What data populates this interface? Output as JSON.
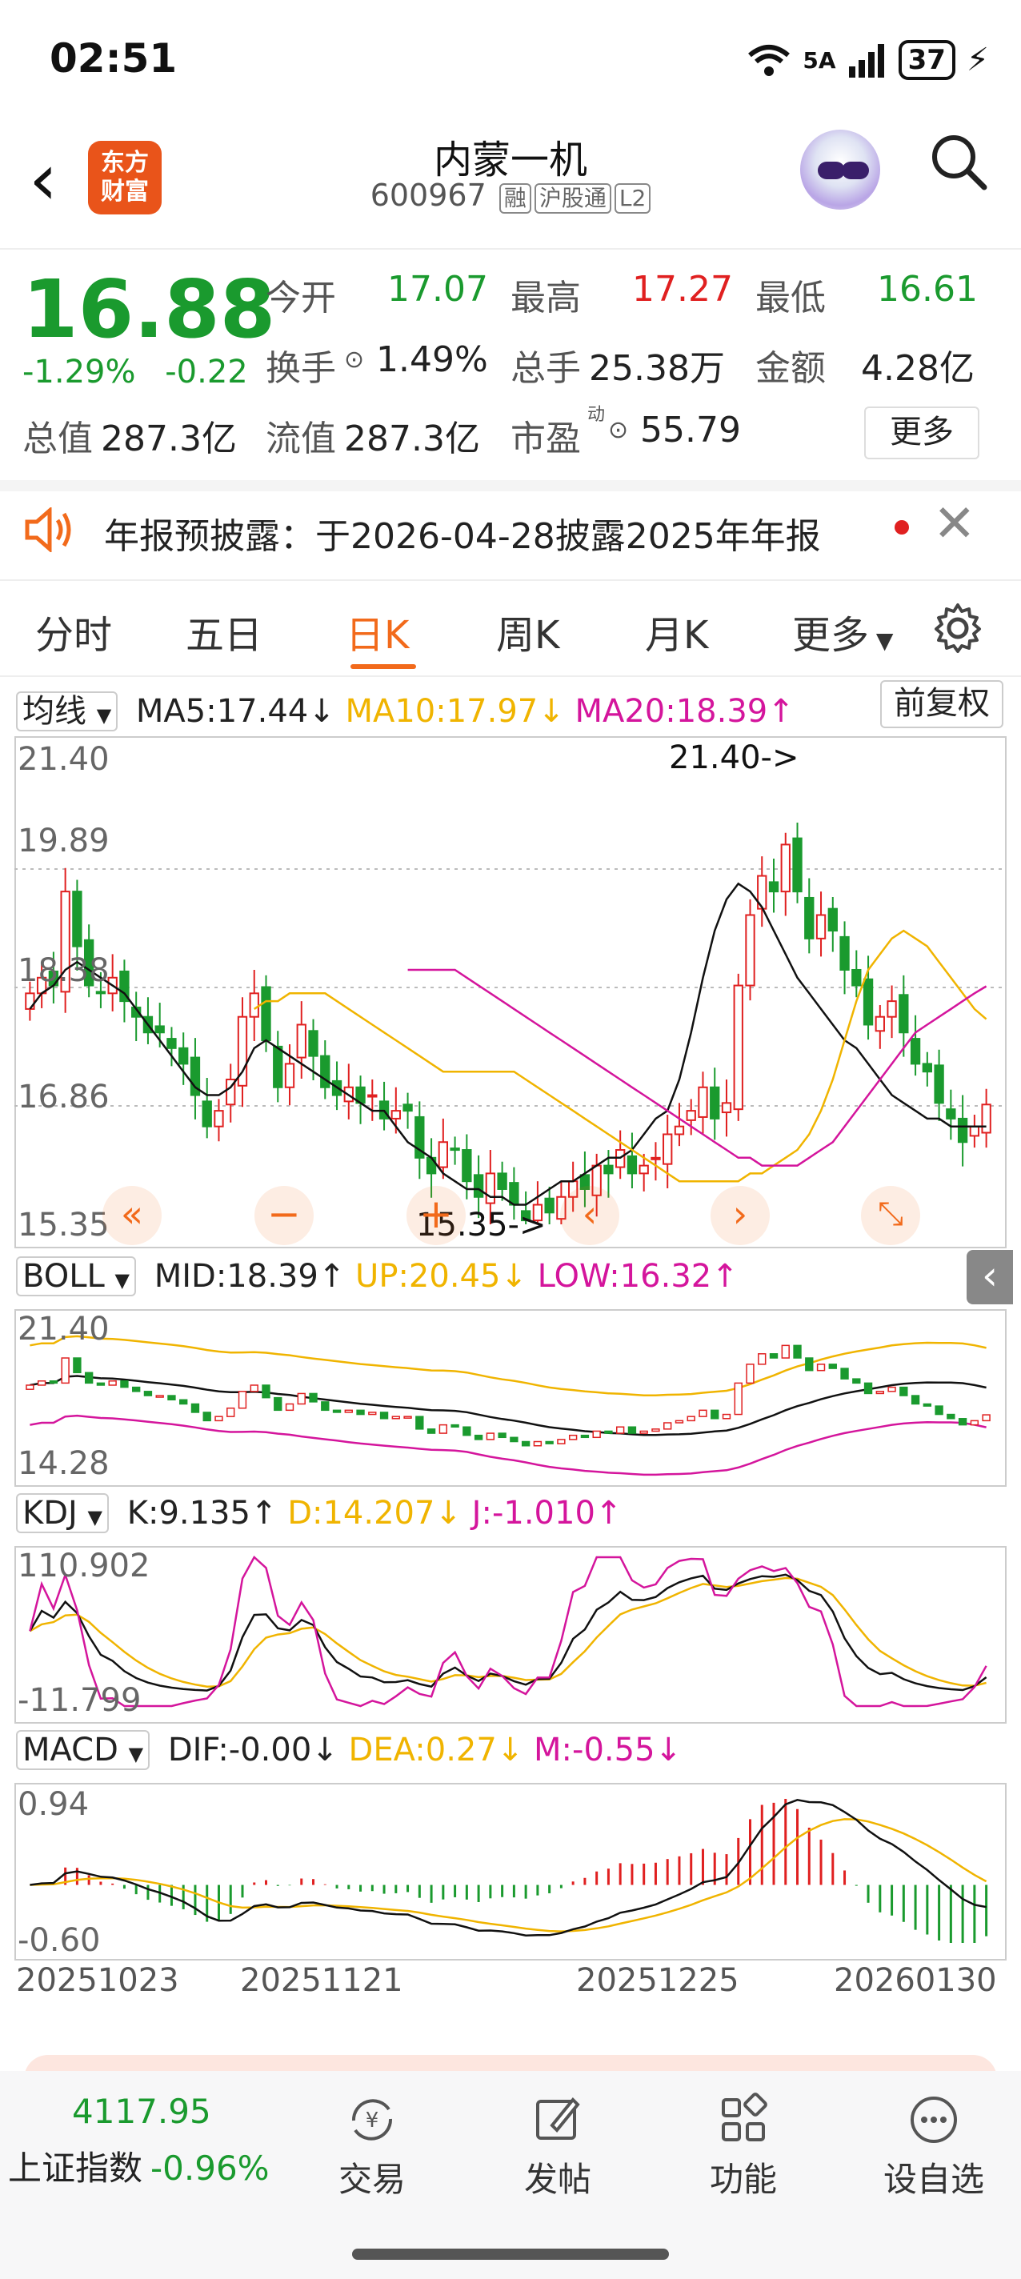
{
  "status": {
    "time": "02:51",
    "network": "5A",
    "battery": "37"
  },
  "header": {
    "title": "内蒙一机",
    "code": "600967",
    "tags": [
      "融",
      "沪股通",
      "L2"
    ],
    "logo_line1": "东方",
    "logo_line2": "财富"
  },
  "quote": {
    "price": "16.88",
    "change_pct": "-1.29%",
    "change_amt": "-0.22",
    "open_label": "今开",
    "open": "17.07",
    "high_label": "最高",
    "high": "17.27",
    "low_label": "最低",
    "low": "16.61",
    "turnover_label": "换手",
    "turnover": "1.49%",
    "volume_label": "总手",
    "volume": "25.38万",
    "amount_label": "金额",
    "amount": "4.28亿",
    "mcap_label": "总值",
    "mcap": "287.3亿",
    "float_label": "流值",
    "float_cap": "287.3亿",
    "pe_label": "市盈",
    "pe_sup": "动",
    "pe": "55.79",
    "more_button": "更多"
  },
  "notice": {
    "text": "年报预披露：于2026-04-28披露2025年年报"
  },
  "tabs": [
    "分时",
    "五日",
    "日K",
    "周K",
    "月K",
    "更多"
  ],
  "active_tab": 2,
  "indicators": {
    "ma": {
      "select": "均线",
      "ma5": "MA5:17.44",
      "ma10": "MA10:17.97",
      "ma20": "MA20:18.39",
      "adjust": "前复权"
    },
    "boll": {
      "select": "BOLL",
      "mid": "MID:18.39",
      "up": "UP:20.45",
      "low": "LOW:16.32"
    },
    "kdj": {
      "select": "KDJ",
      "k": "K:9.135",
      "d": "D:14.207",
      "j": "J:-1.010"
    },
    "macd": {
      "select": "MACD",
      "dif": "DIF:-0.00",
      "dea": "DEA:0.27",
      "m": "M:-0.55"
    }
  },
  "axes": {
    "main": [
      "21.40",
      "19.89",
      "18.38",
      "16.86",
      "15.35"
    ],
    "boll": [
      "21.40",
      "14.28"
    ],
    "kdj": [
      "110.902",
      "-11.799"
    ],
    "macd": [
      "0.94",
      "-0.60"
    ],
    "dates": [
      "20251023",
      "20251121",
      "20251225",
      "20260130"
    ]
  },
  "annotations": {
    "high": "21.40->",
    "low": "15.35->"
  },
  "colors": {
    "up": "#e02020",
    "down": "#1a9a2e",
    "accent": "#f26a1b",
    "ma10": "#f0b400",
    "ma20": "#d4159c"
  },
  "chart_data": {
    "type": "candlestick",
    "ylim": [
      15.35,
      21.4
    ],
    "close": [
      18.3,
      18.5,
      18.4,
      19.6,
      18.9,
      18.4,
      18.3,
      18.5,
      18.2,
      18.0,
      17.8,
      17.8,
      17.6,
      17.4,
      17.0,
      16.6,
      16.8,
      17.2,
      18.0,
      18.3,
      17.7,
      17.1,
      17.4,
      17.9,
      17.5,
      17.1,
      17.0,
      17.1,
      16.9,
      17.0,
      16.7,
      16.8,
      16.8,
      16.2,
      16.0,
      16.4,
      16.3,
      15.9,
      15.7,
      16.0,
      15.8,
      15.6,
      15.4,
      15.6,
      15.5,
      15.7,
      15.9,
      15.8,
      16.1,
      16.0,
      16.3,
      16.0,
      16.1,
      16.2,
      16.5,
      16.6,
      16.8,
      17.1,
      16.7,
      16.9,
      18.4,
      19.3,
      19.8,
      19.6,
      20.2,
      19.6,
      19.0,
      19.3,
      19.1,
      18.6,
      18.4,
      17.9,
      18.0,
      18.2,
      17.8,
      17.4,
      17.3,
      16.9,
      16.7,
      16.4,
      16.6,
      16.88
    ],
    "ma5": [
      18.1,
      18.3,
      18.4,
      18.6,
      18.7,
      18.6,
      18.5,
      18.4,
      18.3,
      18.1,
      17.9,
      17.7,
      17.5,
      17.3,
      17.1,
      17.0,
      17.0,
      17.1,
      17.3,
      17.6,
      17.7,
      17.6,
      17.5,
      17.4,
      17.3,
      17.2,
      17.1,
      17.0,
      16.9,
      16.8,
      16.8,
      16.6,
      16.4,
      16.3,
      16.2,
      16.0,
      15.9,
      15.8,
      15.8,
      15.7,
      15.7,
      15.6,
      15.6,
      15.7,
      15.8,
      15.9,
      15.9,
      16.0,
      16.1,
      16.2,
      16.2,
      16.3,
      16.5,
      16.7,
      16.8,
      17.2,
      17.8,
      18.5,
      19.1,
      19.5,
      19.7,
      19.6,
      19.4,
      19.1,
      18.8,
      18.5,
      18.3,
      18.1,
      17.9,
      17.7,
      17.6,
      17.4,
      17.2,
      17.0,
      16.9,
      16.8,
      16.7,
      16.7,
      16.6,
      16.6,
      16.6,
      16.6
    ],
    "ma10": [
      18.1,
      18.2,
      18.2,
      18.3,
      18.3,
      18.3,
      18.3,
      18.2,
      18.1,
      18.0,
      17.9,
      17.8,
      17.7,
      17.6,
      17.5,
      17.4,
      17.3,
      17.3,
      17.3,
      17.3,
      17.3,
      17.3,
      17.3,
      17.2,
      17.1,
      17.0,
      16.9,
      16.8,
      16.7,
      16.6,
      16.5,
      16.4,
      16.3,
      16.2,
      16.1,
      16.0,
      15.9,
      15.9,
      15.9,
      15.9,
      15.9,
      15.9,
      16.0,
      16.0,
      16.1,
      16.2,
      16.3,
      16.5,
      16.8,
      17.2,
      17.7,
      18.2,
      18.6,
      18.8,
      19.0,
      19.1,
      19.0,
      18.9,
      18.7,
      18.5,
      18.3,
      18.1,
      17.97
    ],
    "ma20": [
      18.6,
      18.6,
      18.6,
      18.6,
      18.6,
      18.5,
      18.4,
      18.3,
      18.2,
      18.1,
      18.0,
      17.9,
      17.8,
      17.7,
      17.6,
      17.5,
      17.4,
      17.3,
      17.2,
      17.1,
      17.0,
      16.9,
      16.8,
      16.7,
      16.6,
      16.5,
      16.4,
      16.3,
      16.2,
      16.2,
      16.1,
      16.1,
      16.1,
      16.1,
      16.2,
      16.3,
      16.4,
      16.6,
      16.8,
      17.0,
      17.2,
      17.4,
      17.6,
      17.8,
      17.9,
      18.0,
      18.1,
      18.2,
      18.3,
      18.39
    ],
    "boll": {
      "up": "UP:20.45",
      "mid": "MID:18.39",
      "low": "LOW:16.32"
    },
    "kdj": {
      "k": "K:9.135",
      "d": "D:14.207",
      "j": "J:-1.010",
      "range": [
        -11.799,
        110.902
      ]
    },
    "macd": {
      "dif": "DIF:-0.00",
      "dea": "DEA:0.27",
      "m": "M:-0.55",
      "range": [
        -0.6,
        0.94
      ]
    }
  }
}
